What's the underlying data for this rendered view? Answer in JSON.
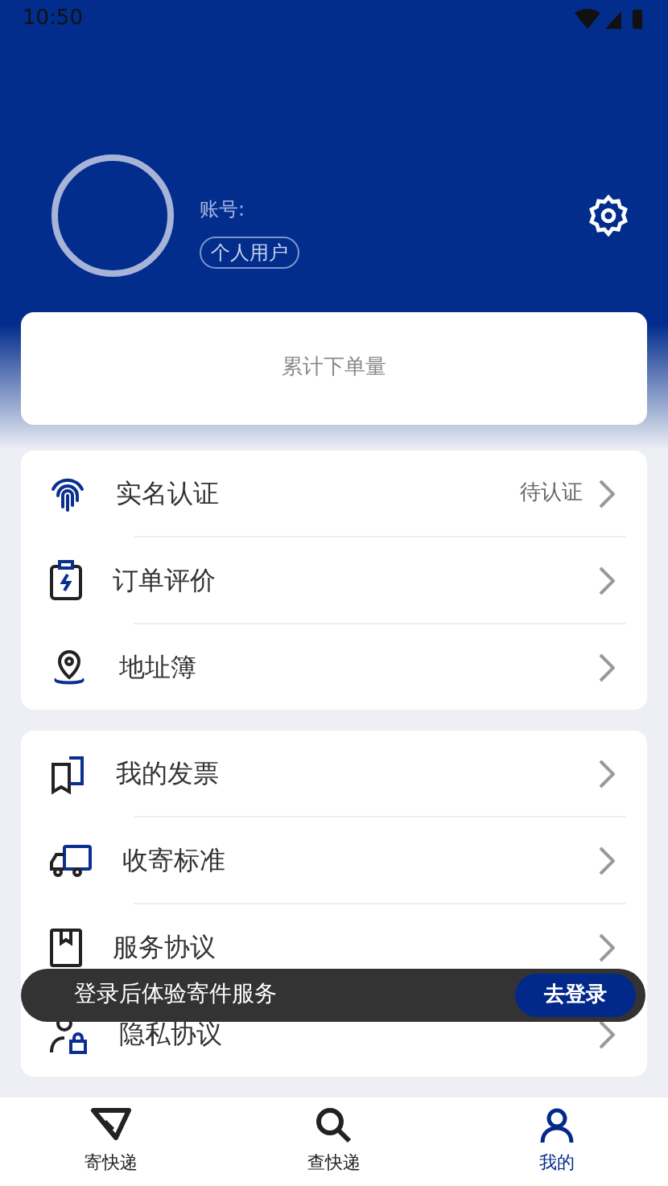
{
  "status_bar": {
    "time": "10:50"
  },
  "profile": {
    "account_label": "账号:",
    "user_type": "个人用户"
  },
  "stats_card": {
    "label": "累计下单量"
  },
  "menu_groups": [
    {
      "items": [
        {
          "label": "实名认证",
          "status": "待认证"
        },
        {
          "label": "订单评价"
        },
        {
          "label": "地址簿"
        }
      ]
    },
    {
      "items": [
        {
          "label": "我的发票"
        },
        {
          "label": "收寄标准"
        },
        {
          "label": "服务协议"
        },
        {
          "label": "隐私协议"
        }
      ]
    }
  ],
  "snackbar": {
    "message": "登录后体验寄件服务",
    "action": "去登录"
  },
  "bottom_nav": [
    {
      "label": "寄快递",
      "selected": false
    },
    {
      "label": "查快递",
      "selected": false
    },
    {
      "label": "我的",
      "selected": true
    }
  ]
}
